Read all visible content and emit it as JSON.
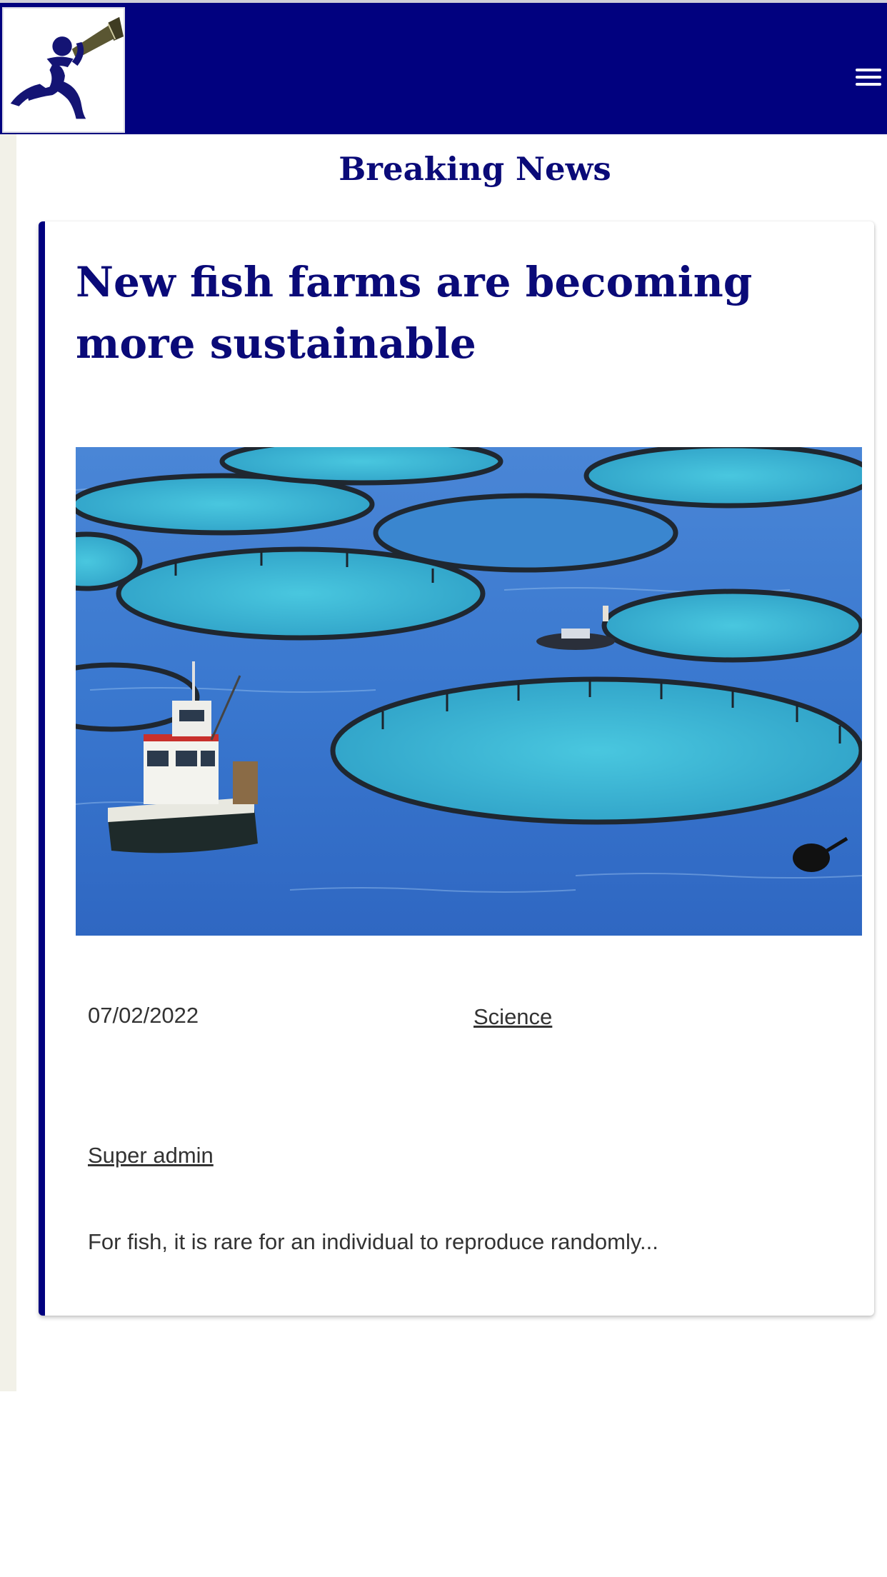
{
  "header": {
    "logo_icon": "runner-with-megaphone-logo",
    "menu_icon": "hamburger-menu-icon",
    "background_color": "#01017f"
  },
  "section": {
    "title": "Breaking News"
  },
  "article": {
    "title": "New fish farms are becoming more sustainable",
    "image_subject": "circular fish farm pens in blue sea with a boat",
    "date": "07/02/2022",
    "category": "Science",
    "author": "Super admin",
    "excerpt": "For fish, it is rare for an individual to reproduce randomly..."
  },
  "colors": {
    "accent": "#01017f",
    "title": "#0a0a78",
    "text": "#333333",
    "side_strip": "#f2f1e8"
  }
}
